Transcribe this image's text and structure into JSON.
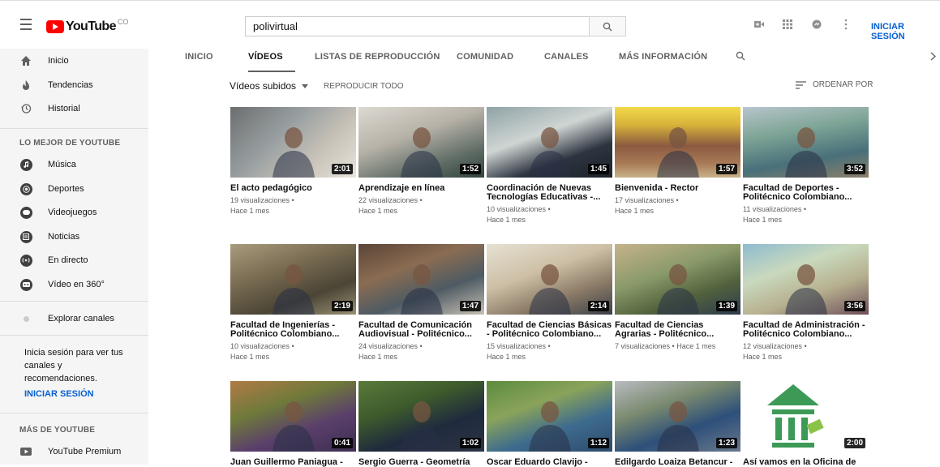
{
  "header": {
    "logo_text": "YouTube",
    "logo_cc": "CO",
    "search_value": "polivirtual",
    "signin_label": "INICIAR SESIÓN"
  },
  "sidebar": {
    "main_items": [
      {
        "label": "Inicio",
        "icon": "home-icon"
      },
      {
        "label": "Tendencias",
        "icon": "fire-icon"
      },
      {
        "label": "Historial",
        "icon": "history-icon"
      }
    ],
    "best_heading": "LO MEJOR DE YOUTUBE",
    "best_items": [
      {
        "label": "Música",
        "icon": "music-icon"
      },
      {
        "label": "Deportes",
        "icon": "sports-icon"
      },
      {
        "label": "Videojuegos",
        "icon": "gaming-icon"
      },
      {
        "label": "Noticias",
        "icon": "news-icon"
      },
      {
        "label": "En directo",
        "icon": "live-icon"
      },
      {
        "label": "Vídeo en 360°",
        "icon": "vr-icon"
      }
    ],
    "explore_label": "Explorar canales",
    "signin_note": "Inicia sesión para ver tus canales y recomendaciones.",
    "signin_label": "INICIAR SESIÓN",
    "more_heading": "MÁS DE YOUTUBE",
    "premium_label": "YouTube Premium"
  },
  "tabs": [
    {
      "label": "INICIO",
      "active": false
    },
    {
      "label": "VÍDEOS",
      "active": true
    },
    {
      "label": "LISTAS DE REPRODUCCIÓN",
      "active": false
    },
    {
      "label": "COMUNIDAD",
      "active": false
    },
    {
      "label": "CANALES",
      "active": false
    },
    {
      "label": "MÁS INFORMACIÓN",
      "active": false
    }
  ],
  "filter": {
    "uploaded_label": "Vídeos subidos",
    "play_all_label": "REPRODUCIR TODO",
    "sort_label": "ORDENAR POR"
  },
  "videos": [
    {
      "title_1": "El acto pedagógico",
      "title_2": "",
      "meta_1": "19 visualizaciones •",
      "meta_2": "Hace 1 mes",
      "duration": "2:01"
    },
    {
      "title_1": "Aprendizaje en línea",
      "title_2": "",
      "meta_1": "22 visualizaciones •",
      "meta_2": "Hace 1 mes",
      "duration": "1:52"
    },
    {
      "title_1": "Coordinación de Nuevas",
      "title_2": "Tecnologías Educativas -...",
      "meta_1": "10 visualizaciones •",
      "meta_2": "Hace 1 mes",
      "duration": "1:45"
    },
    {
      "title_1": "Bienvenida - Rector",
      "title_2": "",
      "meta_1": "17 visualizaciones •",
      "meta_2": "Hace 1 mes",
      "duration": "1:57"
    },
    {
      "title_1": "Facultad de Deportes -",
      "title_2": "Politécnico Colombiano...",
      "meta_1": "11 visualizaciones •",
      "meta_2": "Hace 1 mes",
      "duration": "3:52"
    },
    {
      "title_1": "Facultad de Ingenierías -",
      "title_2": "Politécnico Colombiano...",
      "meta_1": "10 visualizaciones •",
      "meta_2": "Hace 1 mes",
      "duration": "2:19"
    },
    {
      "title_1": "Facultad de Comunicación",
      "title_2": "Audiovisual - Politécnico...",
      "meta_1": "24 visualizaciones •",
      "meta_2": "Hace 1 mes",
      "duration": "1:47"
    },
    {
      "title_1": "Facultad de Ciencias Básicas",
      "title_2": "- Politécnico Colombiano...",
      "meta_1": "15 visualizaciones •",
      "meta_2": "Hace 1 mes",
      "duration": "2:14"
    },
    {
      "title_1": "Facultad de Ciencias",
      "title_2": "Agrarias - Politécnico...",
      "meta_1": "7 visualizaciones • Hace 1 mes",
      "meta_2": "",
      "duration": "1:39"
    },
    {
      "title_1": "Facultad de Administración -",
      "title_2": "Politécnico Colombiano...",
      "meta_1": "12 visualizaciones •",
      "meta_2": "Hace 1 mes",
      "duration": "3:56"
    },
    {
      "title_1": "Juan Guillermo Paniagua -",
      "title_2": "",
      "meta_1": "",
      "meta_2": "",
      "duration": "0:41"
    },
    {
      "title_1": "Sergio Guerra - Geometría",
      "title_2": "",
      "meta_1": "",
      "meta_2": "",
      "duration": "1:02"
    },
    {
      "title_1": "Oscar Eduardo Clavijo -",
      "title_2": "",
      "meta_1": "",
      "meta_2": "",
      "duration": "1:12"
    },
    {
      "title_1": "Edilgardo Loaiza Betancur -",
      "title_2": "",
      "meta_1": "",
      "meta_2": "",
      "duration": "1:23"
    },
    {
      "title_1": "Así vamos en la Oficina de",
      "title_2": "",
      "meta_1": "",
      "meta_2": "",
      "duration": "2:00"
    }
  ],
  "colors": {
    "brand_red": "#ff0000",
    "link_blue": "#065fd4",
    "sidebar_bg": "#f5f5f5"
  }
}
